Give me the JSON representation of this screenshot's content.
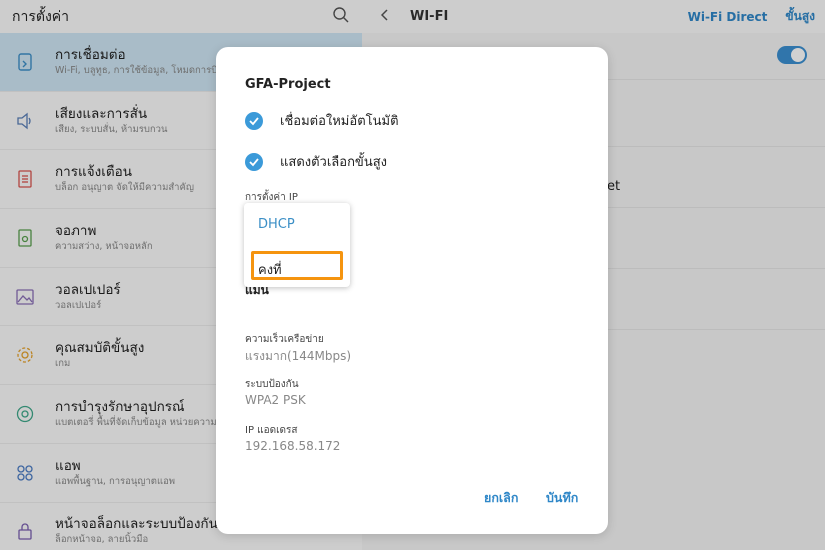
{
  "left_panel": {
    "title": "การตั้งค่า",
    "search_icon": "search-icon",
    "items": [
      {
        "label": "การเชื่อมต่อ",
        "sub": "Wi-Fi, บลูทูธ, การใช้ข้อมูล, โหมดการบิน",
        "icon": "connections-icon",
        "selected": true
      },
      {
        "label": "เสียงและการสั่น",
        "sub": "เสียง, ระบบสั่น, ห้ามรบกวน",
        "icon": "speaker-icon",
        "selected": false
      },
      {
        "label": "การแจ้งเตือน",
        "sub": "บล็อก อนุญาต จัดให้มีความสำคัญ",
        "icon": "notification-icon",
        "selected": false
      },
      {
        "label": "จอภาพ",
        "sub": "ความสว่าง, หน้าจอหลัก",
        "icon": "display-icon",
        "selected": false
      },
      {
        "label": "วอลเปเปอร์",
        "sub": "วอลเปเปอร์",
        "icon": "wallpaper-icon",
        "selected": false
      },
      {
        "label": "คุณสมบัติขั้นสูง",
        "sub": "เกม",
        "icon": "advanced-features-icon",
        "selected": false
      },
      {
        "label": "การบำรุงรักษาอุปกรณ์",
        "sub": "แบตเตอรี่ พื้นที่จัดเก็บข้อมูล หน่วยความจำ",
        "icon": "device-maintenance-icon",
        "selected": false
      },
      {
        "label": "แอพ",
        "sub": "แอพพื้นฐาน, การอนุญาตแอพ",
        "icon": "apps-icon",
        "selected": false
      },
      {
        "label": "หน้าจอล็อกและระบบป้องกัน",
        "sub": "ล็อกหน้าจอ, ลายนิ้วมือ",
        "icon": "lock-icon",
        "selected": false
      }
    ]
  },
  "right_panel": {
    "back_icon": "back-arrow-icon",
    "title": "WI-FI",
    "wifi_direct": "Wi-Fi Direct",
    "advanced": "ขั้นสูง",
    "toggle_on": true,
    "peek_text": "et"
  },
  "dialog": {
    "title": "GFA-Project",
    "options": [
      {
        "label": "เชื่อมต่อใหม่อัตโนมัติ",
        "checked": true
      },
      {
        "label": "แสดงตัวเลือกขั้นสูง",
        "checked": true
      }
    ],
    "ip_settings_label": "การตั้งค่า IP",
    "ip_dropdown": {
      "selected": "DHCP",
      "options": [
        "DHCP",
        "คงที่"
      ]
    },
    "behind_dropdown_text": "แมน",
    "info": [
      {
        "label": "ความเร็วเครือข่าย",
        "value": "แรงมาก(144Mbps)"
      },
      {
        "label": "ระบบป้องกัน",
        "value": "WPA2 PSK"
      },
      {
        "label": "IP แอดเดรส",
        "value": "192.168.58.172"
      }
    ],
    "cancel_label": "ยกเลิก",
    "save_label": "บันทึก"
  },
  "colors": {
    "accent": "#2f87c8",
    "selected_bg": "#cfe6f4",
    "highlight": "#f5940f"
  }
}
